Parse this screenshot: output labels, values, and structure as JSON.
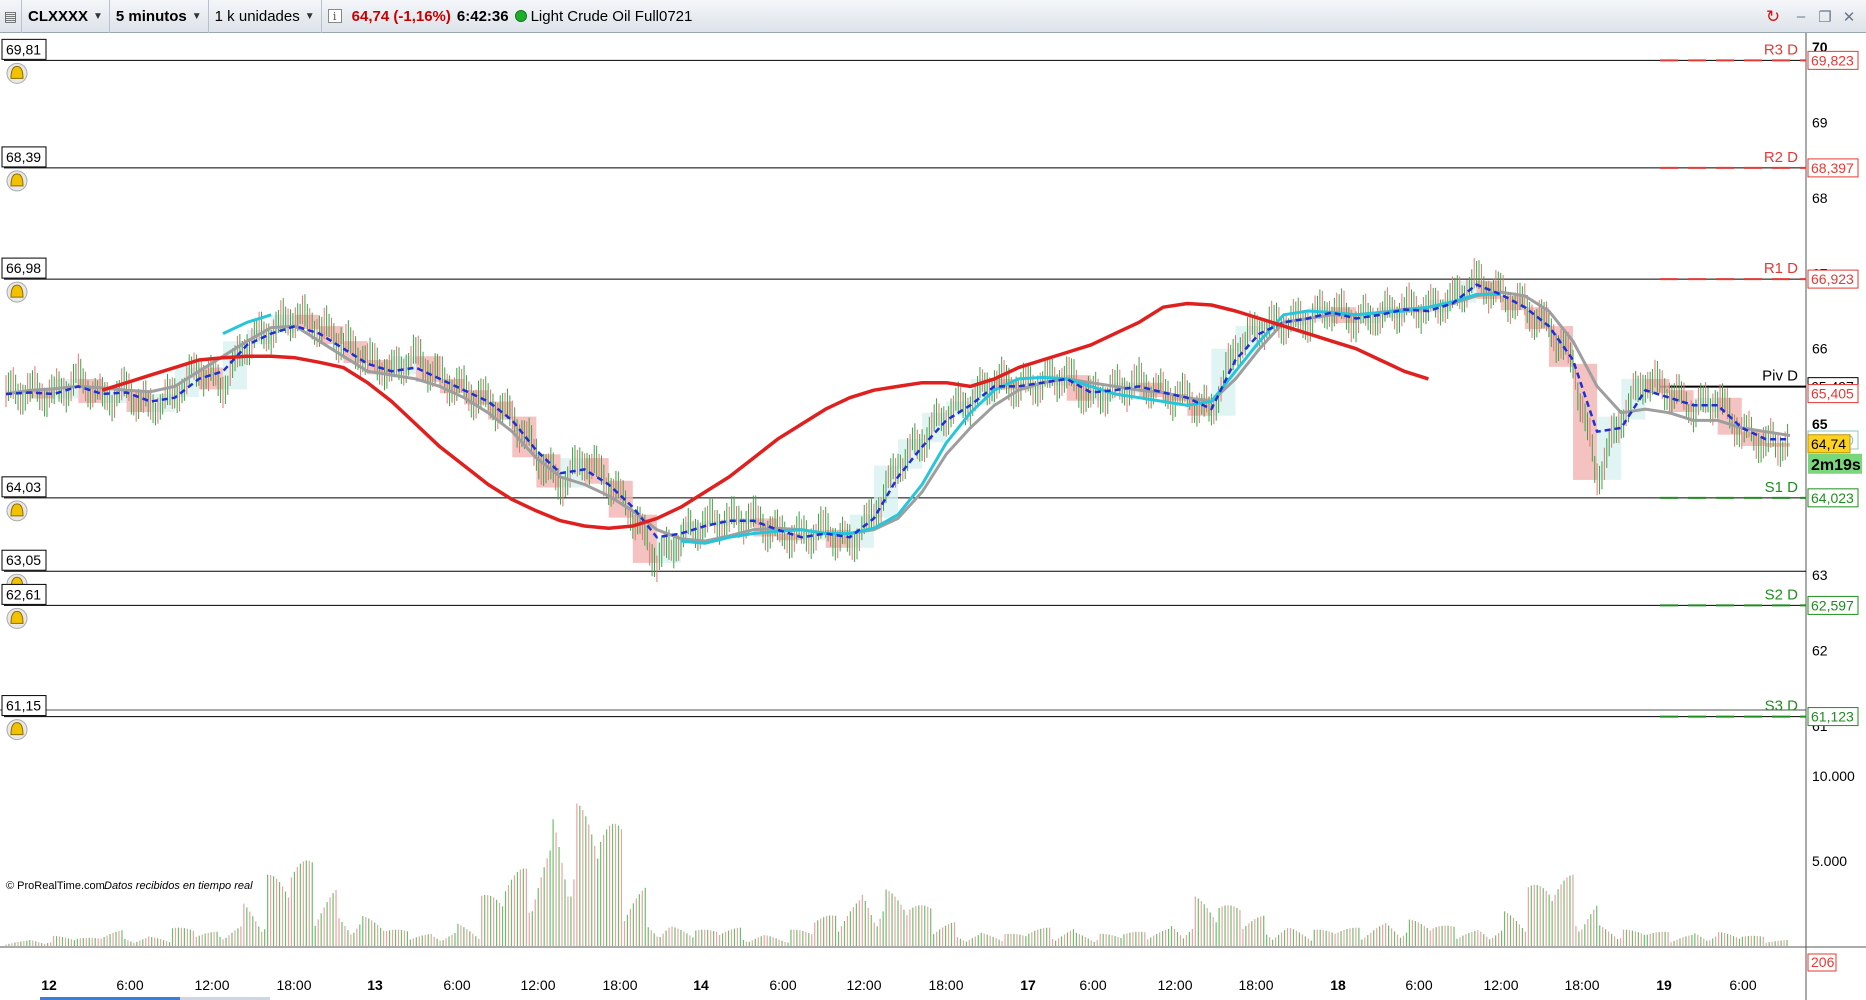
{
  "toolbar": {
    "menu_icon": "grid-menu-icon",
    "symbol": "CLXXXX",
    "timeframe": "5 minutos",
    "units": "1 k unidades",
    "info_icon": "i",
    "quote": "64,74 (-1,16%)",
    "time": "6:42:36",
    "instrument": "Light Crude Oil Full0721",
    "status_color": "#1fae2a",
    "sync_icon": "↻",
    "minimize_icon": "–",
    "restore_icon": "❐",
    "close_icon": "✕"
  },
  "chart_data": {
    "type": "line",
    "title": "",
    "x": [
      "12",
      "6:00",
      "12:00",
      "18:00",
      "13",
      "6:00",
      "12:00",
      "18:00",
      "14",
      "6:00",
      "12:00",
      "18:00",
      "17",
      "6:00",
      "12:00",
      "18:00",
      "18",
      "6:00",
      "12:00",
      "18:00",
      "19",
      "6:00"
    ],
    "x_major": [
      "12",
      "13",
      "14",
      "17",
      "18",
      "19"
    ],
    "ylim": [
      60.7,
      70.2
    ],
    "y_ticks": [
      63,
      62,
      61,
      69,
      68,
      66,
      65,
      70,
      67
    ],
    "price_series": [
      {
        "name": "close",
        "values": [
          65.43,
          65.45,
          65.38,
          65.6,
          65.32,
          65.45,
          65.2,
          65.4,
          65.75,
          65.5,
          66.1,
          66.25,
          66.45,
          66.3,
          66.1,
          65.85,
          65.7,
          65.9,
          65.6,
          65.45,
          65.3,
          65.1,
          64.6,
          64.2,
          64.55,
          64.25,
          63.8,
          63.2,
          63.5,
          63.7,
          63.72,
          63.75,
          63.55,
          63.5,
          63.6,
          63.4,
          63.8,
          64.45,
          64.8,
          65.15,
          65.3,
          65.6,
          65.5,
          65.55,
          65.65,
          65.35,
          65.45,
          65.55,
          65.4,
          65.35,
          65.15,
          66.0,
          66.3,
          66.35,
          66.4,
          66.55,
          66.38,
          66.45,
          66.55,
          66.52,
          66.65,
          66.9,
          66.7,
          66.55,
          66.3,
          65.8,
          64.3,
          65.1,
          65.6,
          65.45,
          65.2,
          65.35,
          64.9,
          64.75,
          64.74
        ]
      },
      {
        "name": "ma-gray",
        "values": [
          65.4,
          65.45,
          65.47,
          65.5,
          65.48,
          65.45,
          65.43,
          65.5,
          65.7,
          65.9,
          66.1,
          66.28,
          66.3,
          66.1,
          65.9,
          65.7,
          65.65,
          65.6,
          65.5,
          65.35,
          65.15,
          64.9,
          64.55,
          64.3,
          64.2,
          64.05,
          63.85,
          63.6,
          63.48,
          63.45,
          63.52,
          63.6,
          63.62,
          63.6,
          63.55,
          63.55,
          63.6,
          63.75,
          64.1,
          64.6,
          64.95,
          65.25,
          65.45,
          65.55,
          65.6,
          65.55,
          65.5,
          65.45,
          65.42,
          65.35,
          65.3,
          65.6,
          66.0,
          66.35,
          66.4,
          66.45,
          66.45,
          66.48,
          66.52,
          66.55,
          66.6,
          66.7,
          66.75,
          66.7,
          66.5,
          66.1,
          65.5,
          65.15,
          65.2,
          65.15,
          65.05,
          65.05,
          64.95,
          64.9,
          64.85
        ]
      },
      {
        "name": "ma-cyan",
        "values": [
          null,
          null,
          null,
          null,
          null,
          null,
          null,
          null,
          null,
          66.2,
          66.35,
          66.45,
          null,
          null,
          null,
          null,
          null,
          null,
          null,
          null,
          null,
          null,
          null,
          null,
          null,
          null,
          null,
          null,
          63.45,
          63.42,
          63.5,
          63.55,
          63.58,
          63.6,
          63.55,
          63.55,
          63.62,
          63.8,
          64.2,
          64.75,
          65.15,
          65.45,
          65.6,
          65.62,
          65.6,
          65.5,
          65.4,
          65.35,
          65.3,
          65.25,
          65.3,
          65.7,
          66.1,
          66.45,
          66.5,
          66.48,
          66.45,
          66.48,
          66.5,
          66.55,
          66.62,
          66.72,
          66.72,
          null,
          null,
          null,
          null,
          null,
          null,
          null,
          null,
          null,
          null,
          null,
          null
        ]
      },
      {
        "name": "ma-blue-dashed",
        "values": [
          65.4,
          65.42,
          65.4,
          65.5,
          65.4,
          65.42,
          65.3,
          65.35,
          65.6,
          65.7,
          66.05,
          66.2,
          66.3,
          66.2,
          66.0,
          65.8,
          65.7,
          65.75,
          65.6,
          65.45,
          65.3,
          65.05,
          64.65,
          64.35,
          64.4,
          64.2,
          63.9,
          63.5,
          63.55,
          63.65,
          63.72,
          63.72,
          63.6,
          63.5,
          63.55,
          63.5,
          63.75,
          64.3,
          64.7,
          65.05,
          65.25,
          65.5,
          65.5,
          65.55,
          65.6,
          65.42,
          65.45,
          65.5,
          65.42,
          65.35,
          65.2,
          65.85,
          66.2,
          66.35,
          66.4,
          66.48,
          66.4,
          66.45,
          66.52,
          66.5,
          66.6,
          66.85,
          66.72,
          66.55,
          66.3,
          65.85,
          64.9,
          64.95,
          65.45,
          65.35,
          65.25,
          65.25,
          64.95,
          64.8,
          64.8
        ]
      },
      {
        "name": "ma-red",
        "values": [
          null,
          null,
          null,
          null,
          65.45,
          65.55,
          65.65,
          65.75,
          65.85,
          65.88,
          65.9,
          65.9,
          65.88,
          65.82,
          65.75,
          65.55,
          65.3,
          65.0,
          64.7,
          64.45,
          64.2,
          64.0,
          63.85,
          63.72,
          63.65,
          63.62,
          63.65,
          63.75,
          63.9,
          64.1,
          64.3,
          64.55,
          64.8,
          65.0,
          65.2,
          65.35,
          65.45,
          65.5,
          65.55,
          65.55,
          65.5,
          65.6,
          65.75,
          65.85,
          65.95,
          66.05,
          66.2,
          66.35,
          66.55,
          66.6,
          66.58,
          66.5,
          66.4,
          66.3,
          66.2,
          66.1,
          66.0,
          65.85,
          65.7,
          65.6
        ]
      }
    ],
    "levels": [
      {
        "name": "R3 D",
        "value": 69.823,
        "label": "69,823",
        "box": "69,81",
        "color": "#e53935",
        "style": "dashed"
      },
      {
        "name": "R2 D",
        "value": 68.397,
        "label": "68,397",
        "box": "68,39",
        "color": "#e53935",
        "style": "dashed"
      },
      {
        "name": "R1 D",
        "value": 66.923,
        "label": "66,923",
        "box": "66,98",
        "color": "#e53935",
        "style": "dashed"
      },
      {
        "name": "Piv D",
        "value": 65.497,
        "label": "65,497",
        "color": "#000000",
        "style": "solid"
      },
      {
        "name": "S1 D",
        "value": 64.023,
        "label": "64,023",
        "box": "64,03",
        "color": "#1e8e1e",
        "style": "dashed"
      },
      {
        "name": "",
        "value": 63.05,
        "box": "63,05",
        "color": "#000000",
        "style": "none"
      },
      {
        "name": "S2 D",
        "value": 62.597,
        "label": "62,597",
        "box": "62,61",
        "color": "#1e8e1e",
        "style": "dashed"
      },
      {
        "name": "S3 D",
        "value": 61.123,
        "label": "61,123",
        "box": "61,15",
        "color": "#1e8e1e",
        "style": "dashed"
      }
    ],
    "right_labels": [
      {
        "text": "65,405",
        "value": 65.405,
        "color": "#e53935"
      },
      {
        "text": "64,790",
        "value": 64.79,
        "color": "#8fc8c0"
      }
    ],
    "current_price": {
      "value": 64.74,
      "label": "64,74",
      "countdown": "2m19s"
    },
    "volume": {
      "ylim": [
        0,
        13000
      ],
      "ticks": [
        "10.000",
        "5.000"
      ],
      "last_label": "206",
      "values": [
        300,
        400,
        500,
        400,
        800,
        600,
        500,
        900,
        700,
        1200,
        2500,
        3500,
        4200,
        3000,
        2000,
        1500,
        800,
        600,
        900,
        1200,
        2500,
        3800,
        5500,
        8000,
        7000,
        6000,
        3000,
        1500,
        1000,
        800,
        900,
        700,
        600,
        800,
        1500,
        2500,
        3500,
        2800,
        2000,
        1200,
        800,
        700,
        600,
        900,
        1000,
        800,
        600,
        700,
        900,
        1500,
        2500,
        2000,
        1500,
        1200,
        1000,
        800,
        900,
        1200,
        1500,
        1300,
        1000,
        800,
        1200,
        1800,
        3000,
        3500,
        2500,
        1200,
        800,
        700,
        600,
        900,
        700,
        500,
        300
      ],
      "colors": [
        "#e8a3a3",
        "#6bbf6b"
      ]
    },
    "copyright": "© ProRealTime.com",
    "realtime": "Datos recibidos en tiempo real"
  }
}
